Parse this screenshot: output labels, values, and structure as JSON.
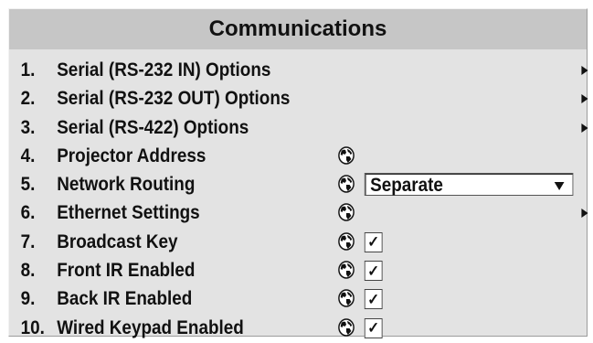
{
  "title": "Communications",
  "menu": [
    {
      "number": "1.",
      "label": "Serial (RS-232 IN) Options",
      "submenu": true
    },
    {
      "number": "2.",
      "label": "Serial (RS-232 OUT) Options",
      "submenu": true
    },
    {
      "number": "3.",
      "label": "Serial (RS-422) Options",
      "submenu": true
    },
    {
      "number": "4.",
      "label": "Projector Address",
      "network": true
    },
    {
      "number": "5.",
      "label": "Network Routing",
      "network": true,
      "select_value": "Separate"
    },
    {
      "number": "6.",
      "label": "Ethernet Settings",
      "network": true,
      "submenu": true
    },
    {
      "number": "7.",
      "label": "Broadcast Key",
      "network": true,
      "check": "✓"
    },
    {
      "number": "8.",
      "label": "Front IR Enabled",
      "network": true,
      "check": "✓"
    },
    {
      "number": "9.",
      "label": "Back IR Enabled",
      "network": true,
      "check": "✓"
    },
    {
      "number": "10.",
      "label": "Wired Keypad Enabled",
      "network": true,
      "check": "✓"
    }
  ],
  "icons": {
    "globe": "globe-icon",
    "submenu": "submenu-arrow-icon",
    "dropdown": "dropdown-arrow-icon"
  }
}
